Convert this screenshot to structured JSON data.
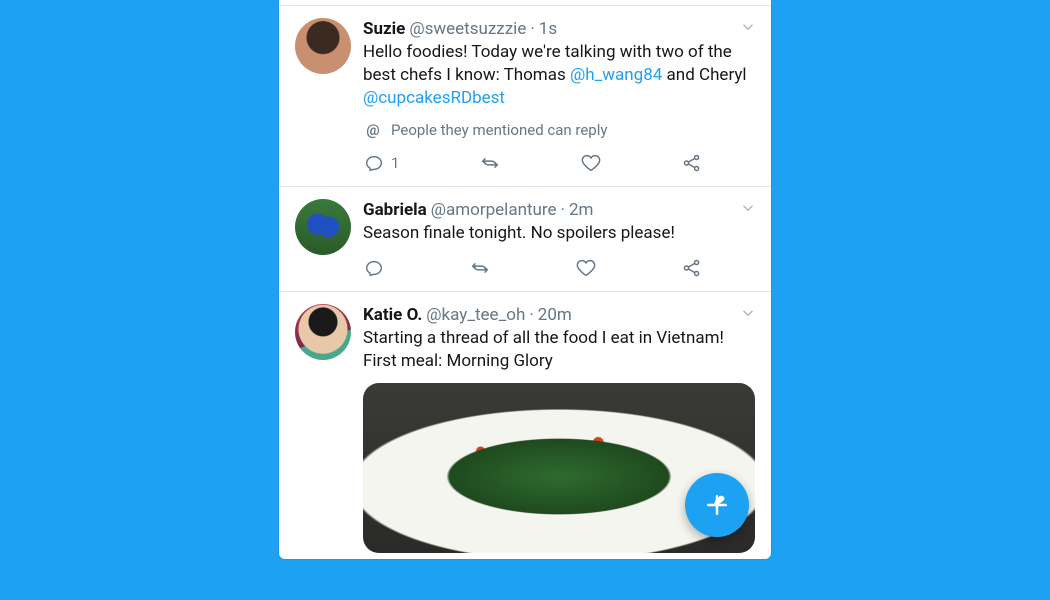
{
  "colors": {
    "accent": "#1da1f2",
    "text": "#14171a",
    "muted": "#657786",
    "border": "#e1e8ed"
  },
  "tweets": [
    {
      "name": "Suzie",
      "handle": "@sweetsuzzzie",
      "time": "1s",
      "body_parts": [
        "Hello foodies! Today we're talking with two of the best chefs I know: Thomas ",
        "@h_wang84",
        " and Cheryl ",
        "@cupcakesRDbest"
      ],
      "reply_hint": "People they mentioned can reply",
      "reply_count": "1"
    },
    {
      "name": "Gabriela",
      "handle": "@amorpelanture",
      "time": "2m",
      "body": "Season finale tonight. No spoilers please!"
    },
    {
      "name": "Katie O.",
      "handle": "@kay_tee_oh",
      "time": "20m",
      "body": "Starting a thread of all the food I eat in Vietnam! First meal: Morning Glory"
    }
  ],
  "icons": {
    "reply": "reply-icon",
    "retweet": "retweet-icon",
    "like": "like-icon",
    "share": "share-icon",
    "caret": "chevron-down-icon",
    "compose": "compose-feather-icon",
    "at": "at-icon"
  },
  "compose_label": "Compose Tweet"
}
